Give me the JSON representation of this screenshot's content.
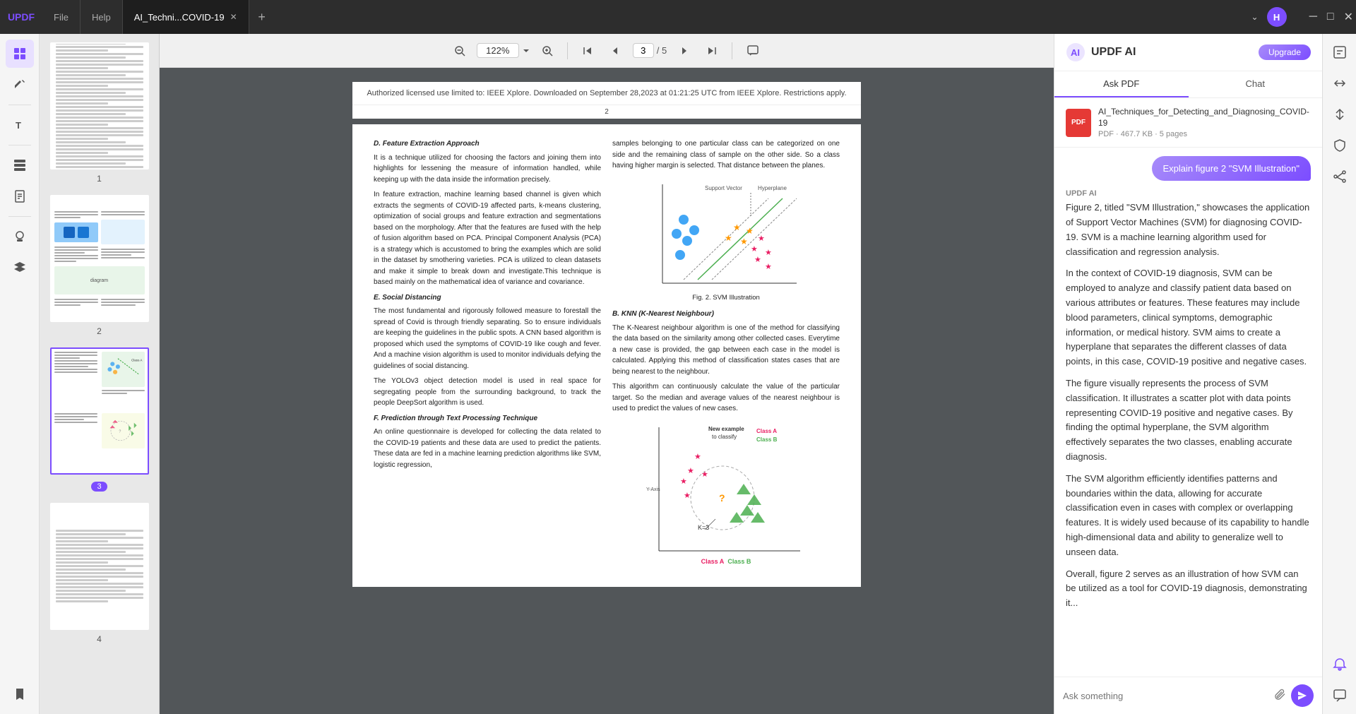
{
  "app": {
    "logo": "UPDF",
    "tab_file": "File",
    "tab_help": "Help",
    "tab_doc": "AI_Techni...COVID-19",
    "tab_add": "+",
    "zoom": "122%",
    "current_page": "3",
    "total_pages": "5"
  },
  "window_controls": {
    "minimize": "−",
    "maximize": "□",
    "close": "×",
    "dropdown": "⌄"
  },
  "sidebar": {
    "icons": [
      {
        "name": "grid-icon",
        "symbol": "⊞",
        "active": true
      },
      {
        "name": "highlight-icon",
        "symbol": "✏️",
        "active": false
      },
      {
        "name": "text-icon",
        "symbol": "T",
        "active": false
      },
      {
        "name": "layout-icon",
        "symbol": "⊟",
        "active": false
      },
      {
        "name": "page-icon",
        "symbol": "📄",
        "active": false
      },
      {
        "name": "stamp-icon",
        "symbol": "◈",
        "active": false
      },
      {
        "name": "layers-icon",
        "symbol": "⊕",
        "active": false
      },
      {
        "name": "bookmark-icon",
        "symbol": "🔖",
        "active": false
      }
    ]
  },
  "thumbnails": [
    {
      "page": "1",
      "active": false
    },
    {
      "page": "2",
      "active": false
    },
    {
      "page": "3",
      "active": true
    },
    {
      "page": "4",
      "active": false
    }
  ],
  "pdf": {
    "page_header": "Authorized licensed use limited to: IEEE Xplore. Downloaded on September 28,2023 at 01:21:25 UTC from IEEE Xplore.  Restrictions apply.",
    "page_num": "2",
    "col1": {
      "section_d": "D.  Feature Extraction Approach",
      "p1": "It is a technique utilized for choosing the factors and joining them into highlights for lessening the measure of information handled, while keeping up with the data inside the information precisely.",
      "p2": "In feature extraction, machine learning based channel is given which extracts the segments of  COVID-19 affected parts, k-means clustering, optimization of social groups and feature extraction and segmentations based on the morphology. After that the features are fused with the help of fusion algorithm based on PCA. Principal Component Analysis (PCA) is a strategy which is accustomed to bring the examples which are solid in the dataset by smothering varieties. PCA is utilized to clean datasets and make it simple to break down and investigate.This technique is based mainly on the mathematical idea of variance and covariance.",
      "section_e": "E.  Social Distancing",
      "p3": "The most fundamental and rigorously followed measure to forestall the spread of Covid is through friendly separating. So to ensure individuals are keeping the guidelines in the public spots. A CNN based algorithm is proposed which used the symptoms of COVID-19 like cough and fever. And a machine vision algorithm is used to monitor individuals defying the guidelines of social distancing.",
      "p4": "The YOLOv3 object detection model is used in real space for segregating people from the surrounding background, to track the people DeepSort algorithm is used.",
      "section_f": "F.  Prediction through Text Processing Technique",
      "p5": "An online questionnaire is developed for collecting the data related to the COVID-19 patients and these data are used to predict the patients. These data are fed in a machine learning prediction algorithms like SVM, logistic regression,"
    },
    "col2": {
      "p1": "samples belonging to one particular class can be categorized on one side and the remaining class of sample on the other side. So a class having higher margin is selected. That distance between the planes.",
      "section_b": "B.  KNN (K-Nearest Neighbour)",
      "p2": "The K-Nearest neighbour algorithm is one of the method for classifying the data based on the similarity among other collected cases. Everytime a new case is provided, the gap between each case in the model is calculated. Applying this method of classification states cases that are being nearest to the neighbour.",
      "p3": "This algorithm can continuously calculate the value of the particular target. So the median and average values of the nearest neighbour is used to predict the values of new cases.",
      "fig2_caption": "Fig. 2.  SVM Illustration",
      "fig3_caption": "New example to classify    Class A\n                                       Class B"
    }
  },
  "ai_panel": {
    "title": "UPDF AI",
    "upgrade_btn": "Upgrade",
    "tabs": [
      "Ask PDF",
      "Chat"
    ],
    "active_tab": "Ask PDF",
    "file": {
      "name": "AI_Techniques_for_Detecting_and_Diagnosing_COVID-19",
      "type": "PDF",
      "meta": "PDF · 467.7 KB · 5 pages"
    },
    "explain_bubble": "Explain figure 2 \"SVM Illustration\"",
    "updf_ai_label": "UPDF AI",
    "response": [
      "Figure 2, titled \"SVM Illustration,\" showcases the application of Support Vector Machines (SVM) for diagnosing COVID-19. SVM is a machine learning algorithm used for classification and regression analysis.",
      "In the context of COVID-19 diagnosis, SVM can be employed to analyze and classify patient data based on various attributes or features. These features may include blood parameters, clinical symptoms, demographic information, or medical history. SVM aims to create a hyperplane that separates the different classes of data points, in this case, COVID-19 positive and negative cases.",
      "The figure visually represents the process of SVM classification. It illustrates a scatter plot with data points representing COVID-19 positive and negative cases. By finding the optimal hyperplane, the SVM algorithm effectively separates the two classes, enabling accurate diagnosis.",
      "The SVM algorithm efficiently identifies patterns and boundaries within the data, allowing for accurate classification even in cases with complex or overlapping features. It is widely used because of its capability to handle high-dimensional data and ability to generalize well to unseen data.",
      "Overall, figure 2 serves as an illustration of how SVM can be utilized as a tool for COVID-19 diagnosis, demonstrating it..."
    ],
    "input_placeholder": "Ask something"
  },
  "right_panel": {
    "icons": [
      {
        "name": "ocr-icon",
        "symbol": "⊞"
      },
      {
        "name": "convert-icon",
        "symbol": "⇄"
      },
      {
        "name": "compress-icon",
        "symbol": "⤓"
      },
      {
        "name": "protect-icon",
        "symbol": "🔒"
      },
      {
        "name": "share-icon",
        "symbol": "↑"
      },
      {
        "name": "notification-icon",
        "symbol": "🔔"
      },
      {
        "name": "chat-icon",
        "symbol": "💬"
      }
    ]
  }
}
